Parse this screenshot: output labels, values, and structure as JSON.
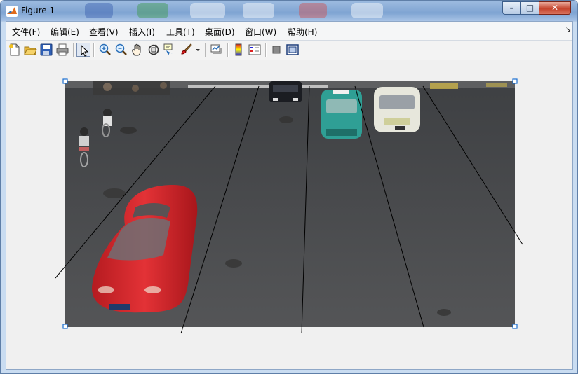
{
  "window": {
    "title": "Figure 1",
    "controls": {
      "minimize": "–",
      "maximize": "□",
      "close": "✕"
    }
  },
  "menubar": {
    "items": [
      "文件(F)",
      "编辑(E)",
      "查看(V)",
      "插入(I)",
      "工具(T)",
      "桌面(D)",
      "窗口(W)",
      "帮助(H)"
    ],
    "dock_glyph": "↘"
  },
  "toolbar": {
    "icons": [
      "new-figure-icon",
      "open-file-icon",
      "save-icon",
      "print-icon",
      "pointer-icon",
      "zoom-in-icon",
      "zoom-out-icon",
      "pan-icon",
      "rotate-3d-icon",
      "data-cursor-icon",
      "brush-icon",
      "brush-dropdown-icon",
      "link-plot-icon",
      "colorbar-icon",
      "legend-icon",
      "hide-plot-tools-icon",
      "show-plot-tools-icon"
    ],
    "selected": "pointer-icon"
  },
  "figure": {
    "content": "traffic-camera photo with overlaid lane boundary lines",
    "colors": {
      "handle": "#1a6fd0",
      "lines": "#000000",
      "road": "#4a4b4d",
      "car_red": "#d9262b"
    }
  }
}
